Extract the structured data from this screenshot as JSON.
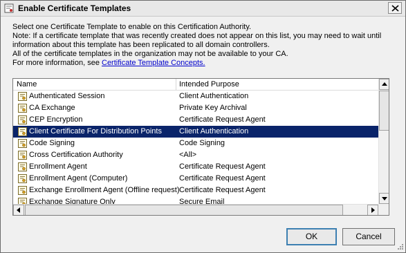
{
  "window": {
    "title": "Enable Certificate Templates",
    "title_icon": "certificate-templates-icon",
    "close_icon": "close-icon"
  },
  "intro": {
    "line1": "Select one Certificate Template to enable on this Certification Authority.",
    "line2": "Note: If a certificate template that was recently created does not appear on this list, you may need to wait until",
    "line3": "information about this template has been replicated to all domain controllers.",
    "line4": "All of the certificate templates in the organization may not be available to your CA.",
    "line5_prefix": "For more information, see ",
    "link_text": "Certificate Template Concepts."
  },
  "list": {
    "columns": {
      "name": "Name",
      "purpose": "Intended Purpose"
    },
    "rows": [
      {
        "name": "Authenticated Session",
        "purpose": "Client Authentication",
        "selected": false
      },
      {
        "name": "CA Exchange",
        "purpose": "Private Key Archival",
        "selected": false
      },
      {
        "name": "CEP Encryption",
        "purpose": "Certificate Request Agent",
        "selected": false
      },
      {
        "name": "Client Certificate For Distribution Points",
        "purpose": "Client Authentication",
        "selected": true
      },
      {
        "name": "Code Signing",
        "purpose": "Code Signing",
        "selected": false
      },
      {
        "name": "Cross Certification Authority",
        "purpose": "<All>",
        "selected": false
      },
      {
        "name": "Enrollment Agent",
        "purpose": "Certificate Request Agent",
        "selected": false
      },
      {
        "name": "Enrollment Agent (Computer)",
        "purpose": "Certificate Request Agent",
        "selected": false
      },
      {
        "name": "Exchange Enrollment Agent (Offline request)",
        "purpose": "Certificate Request Agent",
        "selected": false
      },
      {
        "name": "Exchange Signature Only",
        "purpose": "Secure Email",
        "selected": false
      }
    ],
    "row_icon": "certificate-template-icon"
  },
  "buttons": {
    "ok": "OK",
    "cancel": "Cancel"
  },
  "colors": {
    "selection": "#0a246a",
    "link": "#0000cc",
    "dialog_bg": "#f0f0f0"
  }
}
